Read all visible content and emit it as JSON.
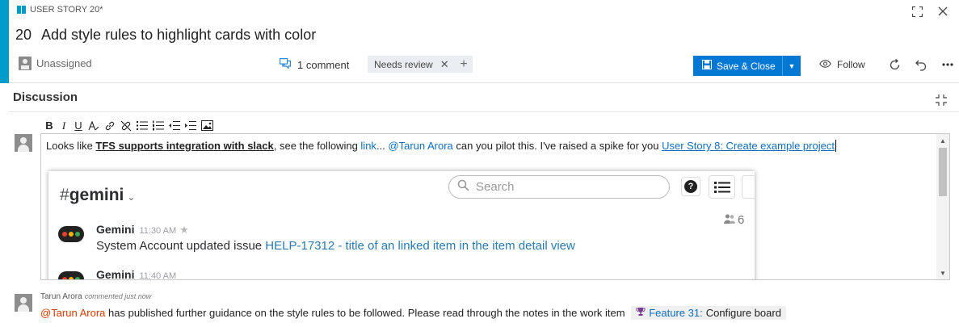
{
  "work_item": {
    "type_label": "USER STORY 20*",
    "id": "20",
    "title": "Add style rules to highlight cards with color",
    "accent_color": "#009ccc"
  },
  "meta": {
    "assignee": "Unassigned",
    "comment_count": "1 comment",
    "tags": [
      "Needs review"
    ],
    "save_label": "Save & Close",
    "follow_label": "Follow"
  },
  "discussion": {
    "title": "Discussion",
    "editor": {
      "text_1": "Looks like ",
      "bold_text": "TFS supports integration with slack",
      "text_2": ", see the following ",
      "link_text": "link",
      "text_3": "... ",
      "mention": "@Tarun Arora",
      "text_4": " can you pilot this. I've raised a spike for you ",
      "story_link": "User Story 8: Create example project"
    },
    "embed": {
      "channel": "gemini",
      "search_placeholder": "Search",
      "member_count": "6",
      "messages": [
        {
          "author": "Gemini",
          "time": "11:30 AM",
          "body_prefix": "System Account updated issue ",
          "body_link": "HELP-17312 - title of an linked item in the item detail view"
        },
        {
          "author": "Gemini",
          "time": "11:40 AM",
          "body_prefix": "",
          "body_link": ""
        }
      ]
    },
    "comment": {
      "author": "Tarun Arora",
      "when": "commented just now",
      "mention": "@Tarun Arora",
      "text": " has published further guidance on the style rules to be followed. Please read through the notes in the work item ",
      "chip_link": "Feature 31:",
      "chip_text": " Configure board"
    }
  },
  "colors": {
    "save_button": "#0078d4",
    "link": "#106ebe",
    "mention": "#d83b01"
  }
}
